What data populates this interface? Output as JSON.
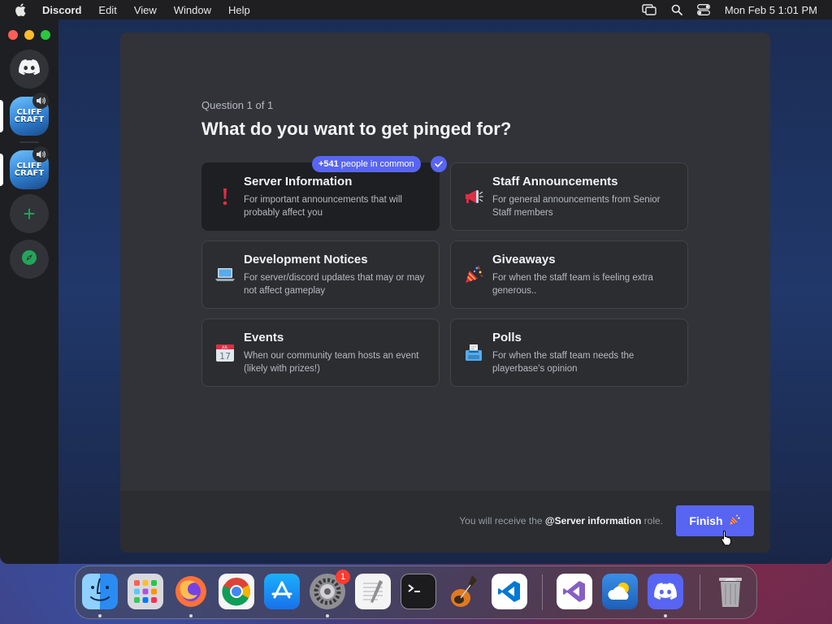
{
  "menubar": {
    "app_name": "Discord",
    "items": [
      "Edit",
      "View",
      "Window",
      "Help"
    ],
    "clock": "Mon Feb 5  1:01 PM"
  },
  "sidebar": {
    "servers": [
      {
        "label": "CLIFF\nCRAFT",
        "voice_active": true
      },
      {
        "label": "CLIFF\nCRAFT",
        "voice_active": true
      }
    ],
    "add_server_icon": "+"
  },
  "onboarding": {
    "counter": "Question 1 of 1",
    "question": "What do you want to get pinged for?",
    "badge_count": "+541",
    "badge_text": "people in common",
    "options": [
      {
        "title": "Server Information",
        "description": "For important announcements that will probably affect you",
        "emoji": "exclamation",
        "selected": true
      },
      {
        "title": "Staff Announcements",
        "description": "For general announcements from Senior Staff members",
        "emoji": "loudspeaker",
        "selected": false
      },
      {
        "title": "Development Notices",
        "description": "For server/discord updates that may or may not affect gameplay",
        "emoji": "laptop",
        "selected": false
      },
      {
        "title": "Giveaways",
        "description": "For when the staff team is feeling extra generous..",
        "emoji": "party-popper",
        "selected": false
      },
      {
        "title": "Events",
        "description": "When our community team hosts an event (likely with prizes!)",
        "emoji": "calendar",
        "selected": false
      },
      {
        "title": "Polls",
        "description": "For when the staff team needs the playerbase's opinion",
        "emoji": "ballot-box",
        "selected": false
      }
    ],
    "calendar_emoji_month": "JUL",
    "calendar_emoji_day": "17",
    "footer": {
      "note_prefix": "You will receive the",
      "role_name": "@Server information",
      "note_suffix": "role.",
      "finish_label": "Finish"
    }
  },
  "dock": {
    "apps": [
      "Finder",
      "Launchpad",
      "Firefox",
      "Chrome",
      "App Store",
      "System Settings",
      "TextEdit",
      "Terminal",
      "GarageBand",
      "Visual Studio Code",
      "Visual Studio",
      "Weather",
      "Discord",
      "Trash"
    ],
    "system_settings_badge": "1"
  },
  "colors": {
    "blurple": "#5865f2",
    "modal_bg": "#313338",
    "footer_bg": "#2b2d31",
    "selected_card": "#1e1f22",
    "add_green": "#23a55a"
  }
}
